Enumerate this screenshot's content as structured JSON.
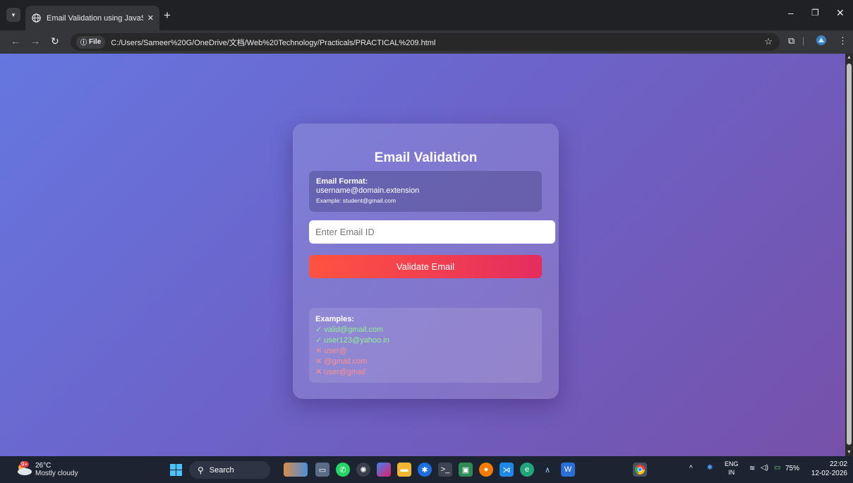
{
  "browser": {
    "tab_title": "Email Validation using JavaScrip",
    "tab_close": "✕",
    "new_tab": "+",
    "file_chip": "File",
    "url": "C:/Users/Sameer%20G/OneDrive/文档/Web%20Technology/Practicals/PRACTICAL%209.html"
  },
  "page": {
    "title": "Email Validation",
    "format_title": "Email Format:",
    "format_pattern": "username@domain.extension",
    "format_example": "Example: student@gmail.com",
    "input_placeholder": "Enter Email ID",
    "input_value": "",
    "button_label": "Validate Email",
    "examples_title": "Examples:",
    "examples": [
      {
        "text": "✓ valid@gmail.com",
        "valid": true
      },
      {
        "text": "✓ user123@yahoo.in",
        "valid": true
      },
      {
        "text": "✕ user@",
        "valid": false
      },
      {
        "text": "✕ @gmail.com",
        "valid": false
      },
      {
        "text": "✕ user@gmail",
        "valid": false
      }
    ],
    "colors": {
      "gradient_start": "#6577e0",
      "gradient_end": "#7651a9",
      "button_start": "#ff5340",
      "button_end": "#e52d5f",
      "valid": "#8ef28e",
      "invalid": "#ff8f8f"
    }
  },
  "taskbar": {
    "temperature": "26°C",
    "weather": "Mostly cloudy",
    "weather_badge": "9+",
    "search_label": "Search",
    "lang_line1": "ENG",
    "lang_line2": "IN",
    "battery": "75%",
    "time": "22:02",
    "date": "12-02-2026"
  }
}
